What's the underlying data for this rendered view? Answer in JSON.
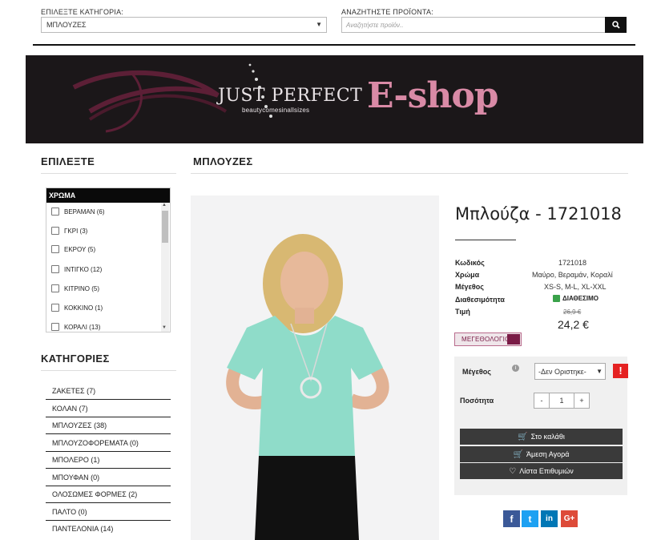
{
  "header": {
    "category_label": "ΕΠΙΛΕΞΤΕ ΚΑΤΗΓΟΡΙΑ:",
    "category_value": "ΜΠΛΟΥΖΕΣ",
    "search_label": "ΑΝΑΖΗΤΗΣΤΕ ΠΡΟΪΟΝΤΑ:",
    "search_placeholder": "Αναζητήστε προϊόν.."
  },
  "banner": {
    "logo_text": "JUST PERFECT",
    "logo_tagline": "beautycomesinallsizes",
    "eshop_text": "E-shop"
  },
  "sidebar": {
    "filter_title": "ΕΠΙΛΕΞΤΕ",
    "color_header": "ΧΡΩΜΑ",
    "colors": [
      {
        "label": "ΒΕΡΑΜΑΝ (6)"
      },
      {
        "label": "ΓΚΡΙ (3)"
      },
      {
        "label": "ΕΚΡΟΥ (5)"
      },
      {
        "label": "ΙΝΤΙΓΚΟ (12)"
      },
      {
        "label": "ΚΙΤΡΙΝΟ (5)"
      },
      {
        "label": "ΚΟΚΚΙΝΟ (1)"
      },
      {
        "label": "ΚΟΡΑΛΙ (13)"
      }
    ],
    "categories_title": "ΚΑΤΗΓΟΡΙΕΣ",
    "categories": [
      {
        "label": "ΖΑΚΕΤΕΣ (7)"
      },
      {
        "label": "ΚΟΛΑΝ (7)"
      },
      {
        "label": "ΜΠΛΟΥΖΕΣ (38)"
      },
      {
        "label": "ΜΠΛΟΥΖΟΦΟΡΕΜΑΤΑ (0)"
      },
      {
        "label": "ΜΠΟΛΕΡΟ (1)"
      },
      {
        "label": "ΜΠΟΥΦΑΝ (0)"
      },
      {
        "label": "ΟΛΟΣΩΜΕΣ ΦΟΡΜΕΣ (2)"
      },
      {
        "label": "ΠΑΛΤΟ (0)"
      },
      {
        "label": "ΠΑΝΤΕΛΟΝΙΑ (14)"
      }
    ]
  },
  "main": {
    "section_title": "ΜΠΛΟΥΖΕΣ"
  },
  "product": {
    "title": "Μπλούζα - 1721018",
    "specs": {
      "code_label": "Κωδικός",
      "code_value": "1721018",
      "color_label": "Χρώμα",
      "color_value": "Μαύρο, Βεραμάν, Κοραλί",
      "size_label": "Μέγεθος",
      "size_value": "XS-S, M-L, XL-XXL",
      "availability_label": "Διαθεσιμότητα",
      "availability_value": "ΔΙΑΘΕΣΙΜΟ",
      "price_label": "Τιμή",
      "old_price": "26,9 €",
      "new_price": "24,2 €"
    },
    "size_chart_label": "ΜΕΓΕΘΟΛΟΓΙΟ",
    "options": {
      "size_label": "Μέγεθος",
      "size_select_value": "-Δεν Οριστηκε-",
      "quantity_label": "Ποσότητα",
      "quantity_value": "1",
      "minus": "-",
      "plus": "+"
    },
    "actions": {
      "add_to_cart": "Στο καλάθι",
      "buy_now": "Άμεση Αγορά",
      "wishlist": "Λίστα Επιθυμιών"
    },
    "social": [
      "f",
      "t",
      "in",
      "G+"
    ]
  },
  "colors": {
    "banner_bg": "#1b1719",
    "eshop_pink": "#d98aa6",
    "facebook": "#3b5998",
    "twitter": "#1da1f2",
    "linkedin": "#0077b5",
    "googleplus": "#dd4b39",
    "available_green": "#3aa24a",
    "alert_red": "#e52222"
  }
}
